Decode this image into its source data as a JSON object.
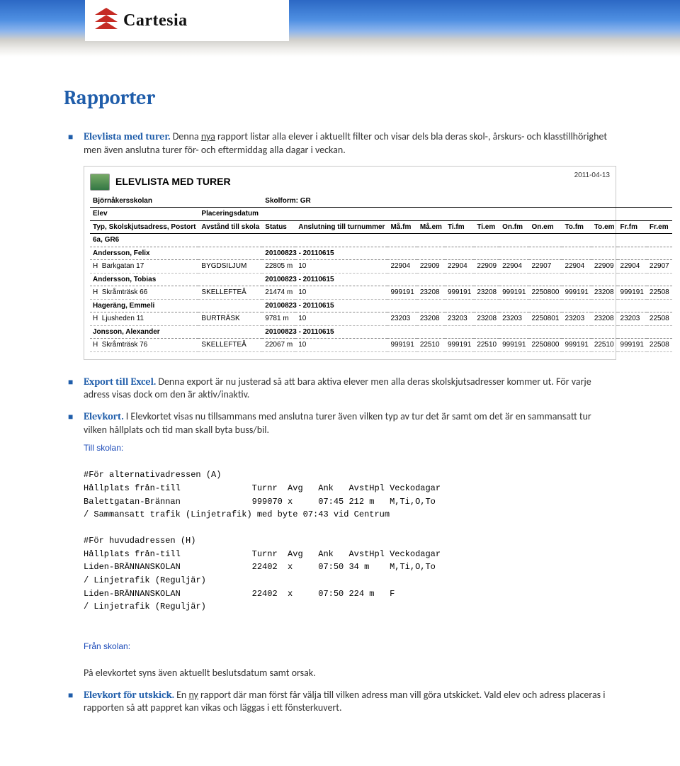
{
  "brand": "Cartesia",
  "h1": "Rapporter",
  "bullets": {
    "b1_lead": "Elevlista med turer.",
    "b1_body": " Denna ",
    "b1_nya": "nya",
    "b1_rest": " rapport listar alla elever i aktuellt filter och visar dels bla deras skol-, årskurs- och klasstillhörighet men även anslutna turer för- och eftermiddag alla dagar i veckan.",
    "b2_lead": "Export till Excel.",
    "b2_body": " Denna export är nu justerad så att bara aktiva elever men alla deras skolskjutsadresser kommer ut. För varje adress visas dock om den är aktiv/inaktiv.",
    "b3_lead": "Elevkort.",
    "b3_body": " I Elevkortet visas nu tillsammans med anslutna turer även vilken typ av tur det är samt om det är en sammansatt tur vilken hållplats och tid man skall byta buss/bil.",
    "b4_body": "På elevkortet syns även aktuellt beslutsdatum samt orsak.",
    "b5_lead": "Elevkort för utskick.",
    "b5_body1": " En ",
    "b5_ny": "ny",
    "b5_body2": " rapport där man först får välja till vilken adress man vill göra utskicket. Vald elev och adress placeras i rapporten så att pappret kan vikas och läggas i ett fönsterkuvert."
  },
  "shot1": {
    "title": "ELEVLISTA MED TURER",
    "date": "2011-04-13",
    "school": "Björnåkersskolan",
    "skolform_lbl": "Skolform:",
    "skolform": "GR",
    "h_elev": "Elev",
    "h_plac": "Placeringsdatum",
    "h_typ": "Typ, Skolskjutsadress, Postort",
    "h_avst": "Avstånd till skola",
    "h_status": "Status",
    "h_ansl": "Anslutning till turnummer",
    "cols": [
      "Må.fm",
      "Må.em",
      "Ti.fm",
      "Ti.em",
      "On.fm",
      "On.em",
      "To.fm",
      "To.em",
      "Fr.fm",
      "Fr.em"
    ],
    "group": "6a, GR6",
    "rows": [
      {
        "name": "Andersson, Felix",
        "dates": "20100823 - 20110615"
      },
      {
        "typ": "H",
        "addr": "Barkgatan 17",
        "ort": "BYGDSILJUM",
        "d": "22805 m",
        "s": "10",
        "t": [
          "22904",
          "22909",
          "22904",
          "22909",
          "22904",
          "22907",
          "22904",
          "22909",
          "22904",
          "22907"
        ]
      },
      {
        "name": "Andersson, Tobias",
        "dates": "20100823 - 20110615"
      },
      {
        "typ": "H",
        "addr": "Skråmträsk 66",
        "ort": "SKELLEFTEÅ",
        "d": "21474 m",
        "s": "10",
        "t": [
          "999191",
          "23208",
          "999191",
          "23208",
          "999191",
          "2250800",
          "999191",
          "23208",
          "999191",
          "22508"
        ]
      },
      {
        "name": "Hageräng, Emmeli",
        "dates": "20100823 - 20110615"
      },
      {
        "typ": "H",
        "addr": "Ljusheden 11",
        "ort": "BURTRÄSK",
        "d": "9781 m",
        "s": "10",
        "t": [
          "23203",
          "23208",
          "23203",
          "23208",
          "23203",
          "2250801",
          "23203",
          "23208",
          "23203",
          "22508"
        ]
      },
      {
        "name": "Jonsson, Alexander",
        "dates": "20100823 - 20110615"
      },
      {
        "typ": "H",
        "addr": "Skråmträsk 76",
        "ort": "SKELLEFTEÅ",
        "d": "22067 m",
        "s": "10",
        "t": [
          "999191",
          "22510",
          "999191",
          "22510",
          "999191",
          "2250800",
          "999191",
          "22510",
          "999191",
          "22508"
        ]
      }
    ]
  },
  "shot2": {
    "tillskolan": "Till skolan:",
    "franskolan": "Från skolan:",
    "lines": [
      "#För alternativadressen (A)",
      "Hållplats från-till              Turnr  Avg   Ank   AvstHpl Veckodagar",
      "Balettgatan-Brännan              999070 x     07:45 212 m   M,Ti,O,To",
      "/ Sammansatt trafik (Linjetrafik) med byte 07:43 vid Centrum",
      "",
      "#För huvudadressen (H)",
      "Hållplats från-till              Turnr  Avg   Ank   AvstHpl Veckodagar",
      "Liden-BRÄNNANSKOLAN              22402  x     07:50 34 m    M,Ti,O,To",
      "/ Linjetrafik (Reguljär)",
      "Liden-BRÄNNANSKOLAN              22402  x     07:50 224 m   F",
      "/ Linjetrafik (Reguljär)"
    ]
  }
}
